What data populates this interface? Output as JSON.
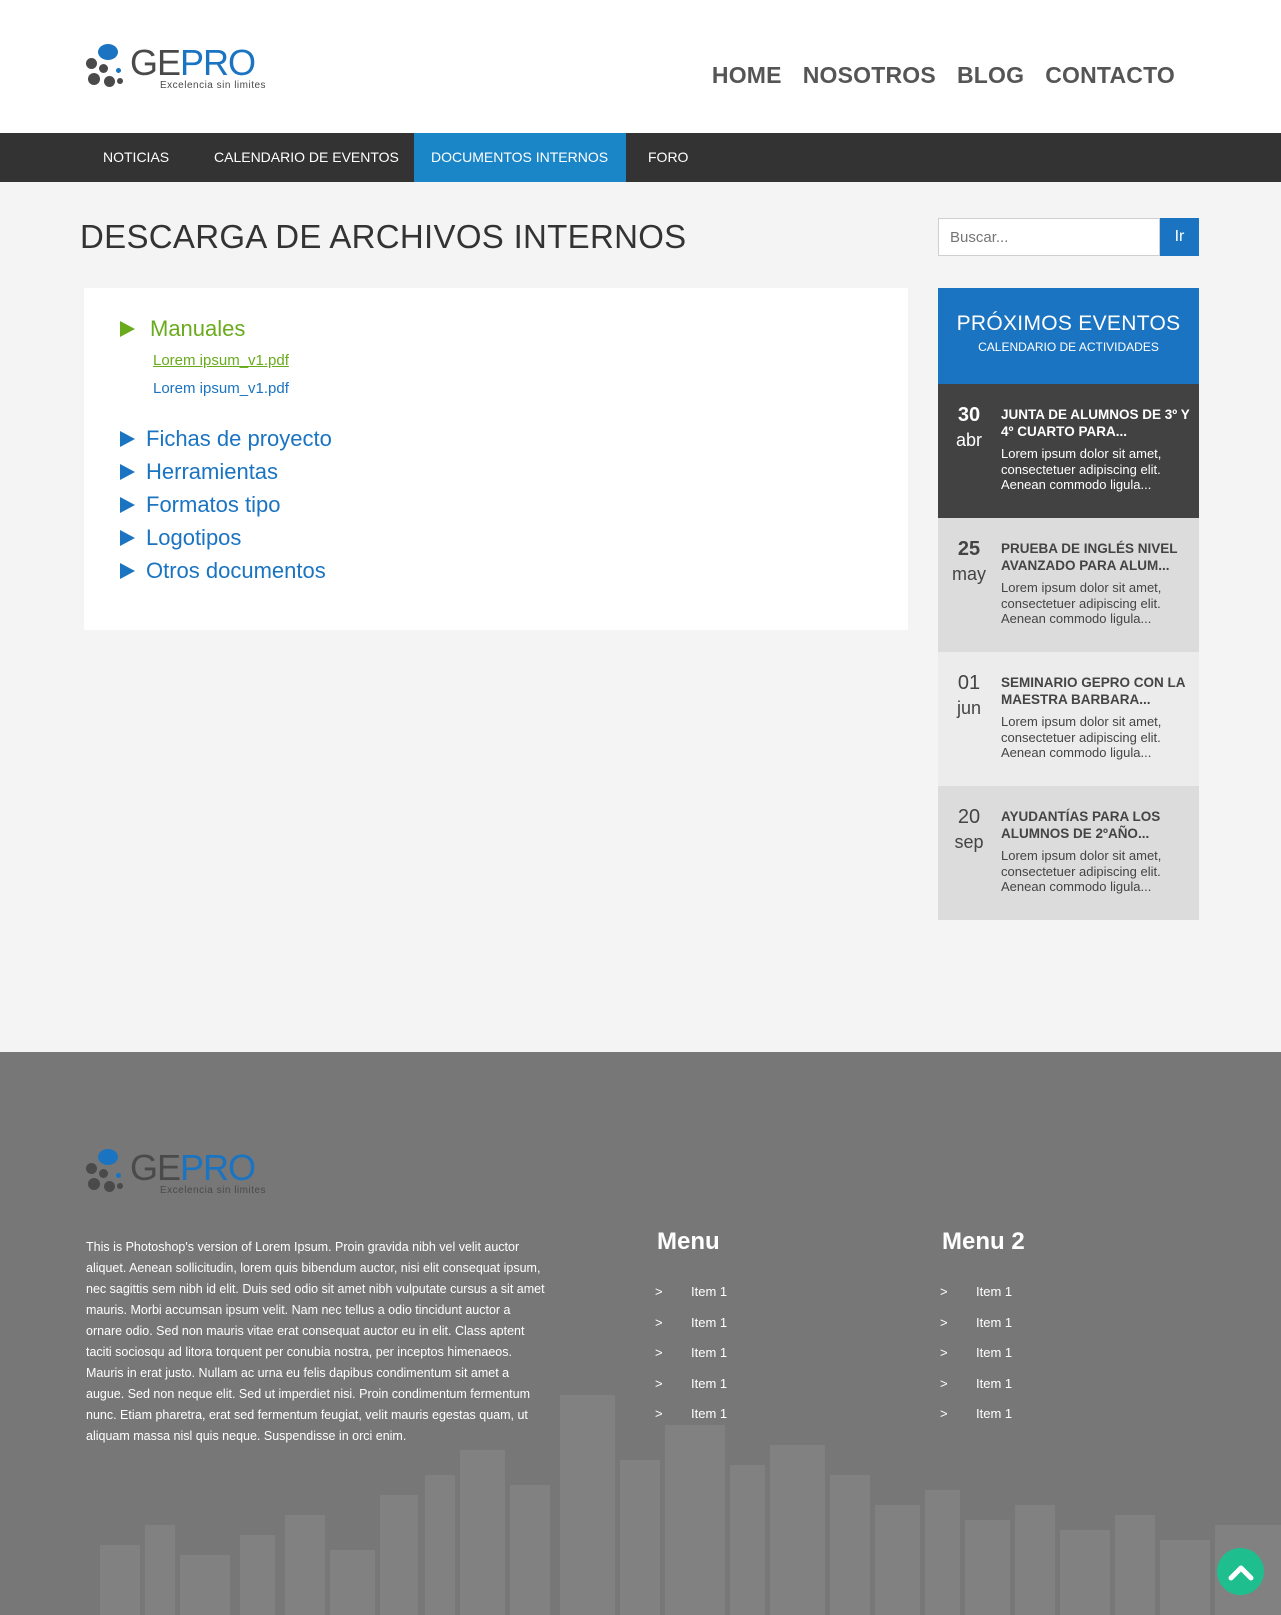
{
  "brand": {
    "word_a": "GE",
    "word_b": "PRO",
    "tagline": "Excelencia sin limites"
  },
  "topnav": [
    "HOME",
    "NOSOTROS",
    "BLOG",
    "CONTACTO"
  ],
  "subnav": {
    "tabs": [
      "NOTICIAS",
      "CALENDARIO DE EVENTOS",
      "DOCUMENTOS INTERNOS",
      "FORO"
    ],
    "active": "DOCUMENTOS INTERNOS"
  },
  "page": {
    "title": "DESCARGA DE ARCHIVOS INTERNOS"
  },
  "documents": {
    "open_category": "Manuales",
    "files": [
      "Lorem ipsum_v1.pdf",
      "Lorem ipsum_v1.pdf"
    ],
    "categories": [
      "Fichas de proyecto",
      "Herramientas",
      "Formatos tipo",
      "Logotipos",
      "Otros documentos"
    ]
  },
  "search": {
    "placeholder": "Buscar...",
    "button": "Ir"
  },
  "events": {
    "heading": "PRÓXIMOS EVENTOS",
    "subheading": "CALENDARIO DE ACTIVIDADES",
    "items": [
      {
        "day": "30",
        "month": "abr",
        "title": "JUNTA DE ALUMNOS DE 3º Y 4º CUARTO PARA...",
        "desc": "Lorem ipsum dolor sit amet, consectetuer adipiscing elit. Aenean commodo ligula..."
      },
      {
        "day": "25",
        "month": "may",
        "title": "PRUEBA DE INGLÉS NIVEL AVANZADO PARA ALUM...",
        "desc": "Lorem ipsum dolor sit amet, consectetuer adipiscing elit. Aenean commodo ligula..."
      },
      {
        "day": "01",
        "month": "jun",
        "title": "SEMINARIO GEPRO CON LA MAESTRA BARBARA...",
        "desc": "Lorem ipsum dolor sit amet, consectetuer adipiscing elit. Aenean commodo ligula..."
      },
      {
        "day": "20",
        "month": "sep",
        "title": "AYUDANTÍAS PARA LOS ALUMNOS DE 2ºAÑO...",
        "desc": "Lorem ipsum dolor sit amet, consectetuer adipiscing elit. Aenean commodo ligula..."
      }
    ]
  },
  "footer": {
    "text": "This is Photoshop's version  of Lorem Ipsum. Proin gravida nibh vel velit auctor aliquet. Aenean sollicitudin, lorem quis bibendum auctor, nisi elit consequat ipsum, nec sagittis sem nibh id elit. Duis sed odio sit amet nibh vulputate cursus a sit amet mauris. Morbi accumsan ipsum velit. Nam nec tellus a odio tincidunt auctor a ornare odio. Sed non  mauris vitae erat consequat auctor eu in elit. Class aptent taciti sociosqu ad litora torquent per conubia nostra, per inceptos himenaeos. Mauris in erat justo. Nullam ac urna eu felis dapibus condimentum sit amet a augue. Sed non neque elit. Sed ut imperdiet nisi. Proin condimentum fermentum nunc. Etiam pharetra, erat sed fermentum feugiat, velit mauris egestas quam, ut aliquam massa nisl quis neque. Suspendisse in orci enim.",
    "menu1": {
      "title": "Menu",
      "items": [
        "Item 1",
        "Item 1",
        "Item 1",
        "Item 1",
        "Item 1"
      ]
    },
    "menu2": {
      "title": "Menu 2",
      "items": [
        "Item 1",
        "Item 1",
        "Item 1",
        "Item 1",
        "Item 1"
      ]
    },
    "bullet": ">"
  },
  "icons": {
    "back_to_top": "chevron-up-icon",
    "category_marker": "triangle-right-icon"
  },
  "colors": {
    "brand_blue": "#1a74c1",
    "active_tab": "#1a86c8",
    "green": "#6aab1d",
    "dark_bar": "#333333",
    "footer": "#777777",
    "to_top": "#1fbe8e"
  }
}
